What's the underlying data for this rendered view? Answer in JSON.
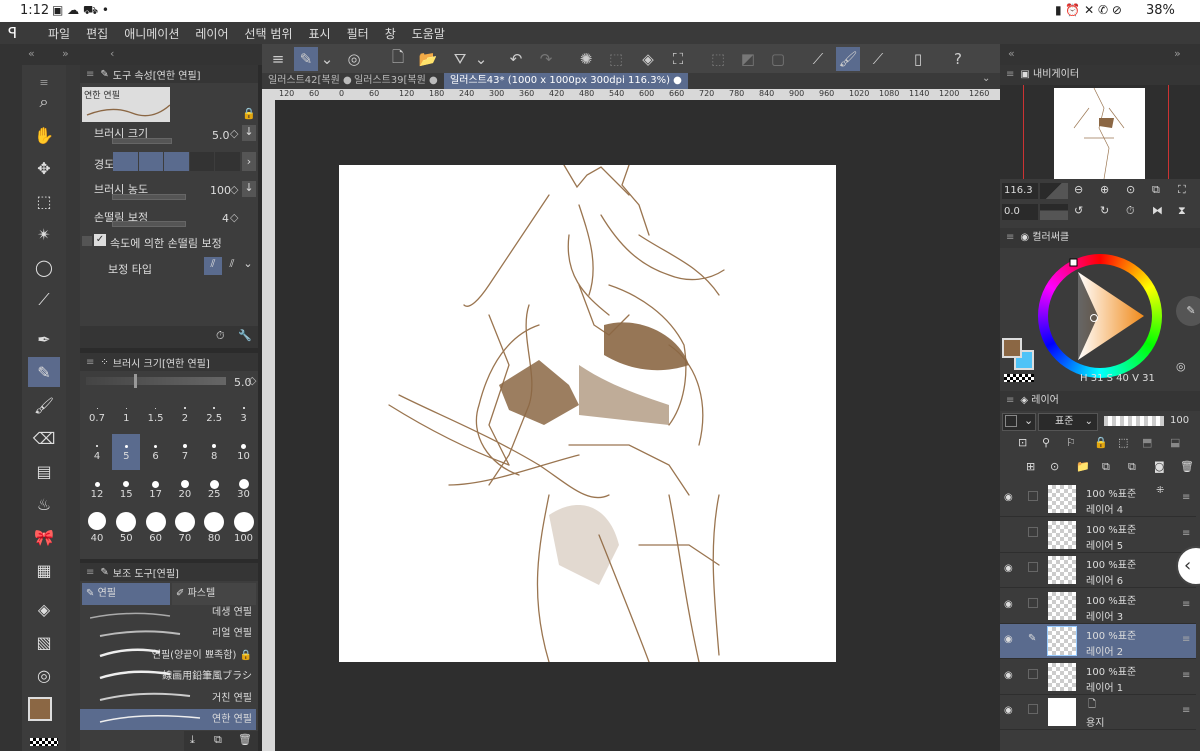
{
  "status": {
    "time": "1:12",
    "battery": "38%"
  },
  "menu": [
    "파일",
    "편집",
    "애니메이션",
    "레이어",
    "선택 범위",
    "표시",
    "필터",
    "창",
    "도움말"
  ],
  "tool_property": {
    "title": "도구 속성[연한 연필]",
    "brush_name": "연한 연필",
    "brush_size_label": "브러시 크기",
    "brush_size": "5.0",
    "hardness_label": "경도",
    "density_label": "브러시 농도",
    "density": "100",
    "stabilization_label": "손떨림 보정",
    "stabilization": "4",
    "speed_stab_label": "속도에 의한 손떨림 보정",
    "correction_type_label": "보정 타입"
  },
  "brush_size_panel": {
    "title": "브러시 크기[연한 연필]",
    "value": "5.0",
    "sizes": [
      "0.7",
      "1",
      "1.5",
      "2",
      "2.5",
      "3",
      "4",
      "5",
      "6",
      "7",
      "8",
      "10",
      "12",
      "15",
      "17",
      "20",
      "25",
      "30",
      "40",
      "50",
      "60",
      "70",
      "80",
      "100"
    ]
  },
  "sub_tool": {
    "title": "보조 도구[연필]",
    "tab_pencil": "연필",
    "tab_pastel": "파스텔",
    "items": [
      "데생 연필",
      "리얼 연필",
      "연필(양끝이 뾰족함)",
      "線画用鉛筆風ブラシ",
      "거친 연필",
      "연한 연필"
    ]
  },
  "tabs": [
    "일러스트42[복원",
    "일러스트39[복원",
    "일러스트43* (1000 x 1000px 300dpi 116.3%)"
  ],
  "ruler_h": [
    "120",
    "60",
    "0",
    "60",
    "120",
    "180",
    "240",
    "300",
    "360",
    "420",
    "480",
    "540",
    "600",
    "660",
    "720",
    "780",
    "840",
    "900",
    "960",
    "1020",
    "1080",
    "1140",
    "1200",
    "1260"
  ],
  "navigator": {
    "title": "내비게이터",
    "zoom": "116.3",
    "angle": "0.0"
  },
  "color": {
    "title": "컬러써클",
    "main": "#8b6744",
    "sub": "#4fc3f7",
    "h": "31",
    "s": "40",
    "v": "31"
  },
  "layers": {
    "title": "레이어",
    "blend": "표준",
    "opacity": "100",
    "items": [
      {
        "pct": "100 %표준",
        "name": "레이어 4"
      },
      {
        "pct": "100 %표준",
        "name": "레이어 5"
      },
      {
        "pct": "100 %표준",
        "name": "레이어 6"
      },
      {
        "pct": "100 %표준",
        "name": "레이어 3"
      },
      {
        "pct": "100 %표준",
        "name": "레이어 2"
      },
      {
        "pct": "100 %표준",
        "name": "레이어 1"
      },
      {
        "pct": "",
        "name": "용지"
      }
    ]
  }
}
